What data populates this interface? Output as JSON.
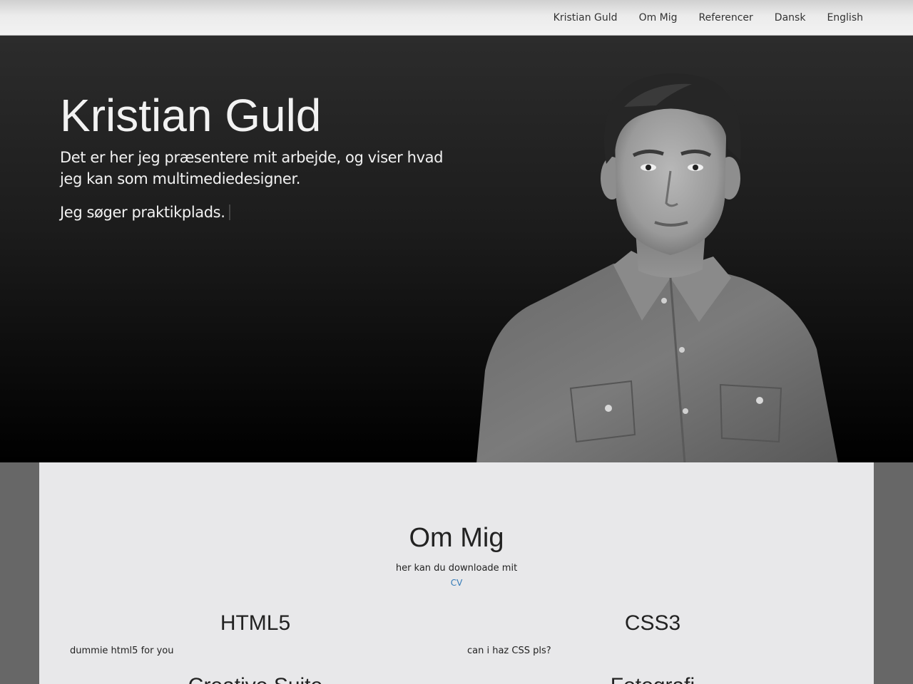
{
  "nav": {
    "items": [
      {
        "label": "Kristian Guld"
      },
      {
        "label": "Om Mig"
      },
      {
        "label": "Referencer"
      },
      {
        "label": "Dansk"
      },
      {
        "label": "English"
      }
    ]
  },
  "hero": {
    "title": "Kristian Guld",
    "subtitle": "Det er her jeg præsentere mit arbejde, og viser hvad jeg kan som multimediedesigner.",
    "line": "Jeg søger praktikplads."
  },
  "about": {
    "title": "Om Mig",
    "text": "her kan du downloade mit",
    "cv_link": "CV"
  },
  "skills": [
    {
      "title": "HTML5",
      "text": "dummie html5 for you"
    },
    {
      "title": "CSS3",
      "text": "can i haz CSS pls?"
    },
    {
      "title": "Creative Suite",
      "text": ""
    },
    {
      "title": "Fotografi",
      "text": ""
    }
  ],
  "colors": {
    "navbar": "#ececec",
    "hero_bg": "#1c1c1c",
    "content_bg": "#e8e8ea",
    "page_bg": "#676767",
    "link": "#337ab7"
  }
}
